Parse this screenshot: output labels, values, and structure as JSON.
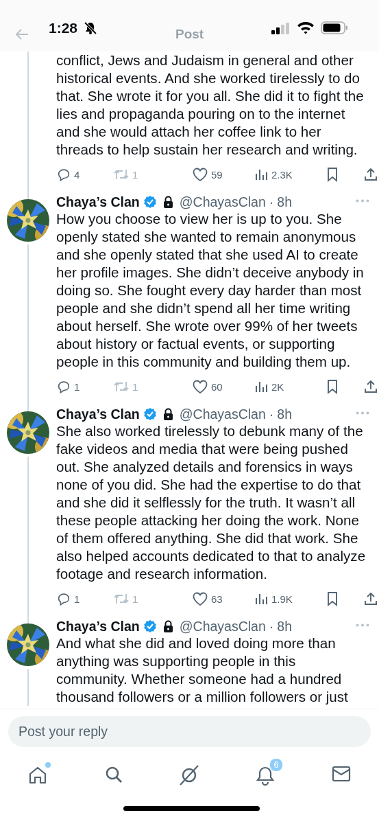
{
  "status_bar": {
    "time": "1:28",
    "silent": true
  },
  "header": {
    "title": "Post"
  },
  "thread": [
    {
      "kind": "continuation",
      "cut_line": "conflict, Jews and Judaism in general and other",
      "text": "historical events. And she worked tirelessly to do that. She wrote it for you all. She did it to fight the lies and propaganda pouring on to the internet and she would attach her coffee link to her threads to help sustain her research and writing.",
      "replies": "4",
      "reposts": "1",
      "reposts_disabled": true,
      "likes": "59",
      "views": "2.3K"
    },
    {
      "kind": "post",
      "name": "Chaya’s Clan",
      "verified": true,
      "protected": true,
      "handle": "@ChayasClan",
      "separator": "·",
      "time": "8h",
      "text": "How you choose to view her is up to you. She openly stated she wanted to remain anonymous and she openly stated that she used AI to create her profile images. She didn’t deceive anybody in doing so. She fought every day harder than most people and she didn’t spend all her time writing about herself. She wrote over 99% of her tweets about history or factual events, or supporting people in this community and building them up.",
      "replies": "1",
      "reposts": "1",
      "reposts_disabled": true,
      "likes": "60",
      "views": "2K"
    },
    {
      "kind": "post",
      "name": "Chaya’s Clan",
      "verified": true,
      "protected": true,
      "handle": "@ChayasClan",
      "separator": "·",
      "time": "8h",
      "text": "She also worked tirelessly to debunk many of the fake videos and media that were being pushed out. She analyzed details and forensics in ways none of you did. She had the expertise to do that and she did it selflessly for the truth. It wasn’t all these people attacking her doing the work. None of them offered anything. She did that work. She also helped accounts dedicated to that to analyze footage and research information.",
      "replies": "1",
      "reposts": "1",
      "reposts_disabled": true,
      "likes": "63",
      "views": "1.9K"
    },
    {
      "kind": "post",
      "name": "Chaya’s Clan",
      "verified": true,
      "protected": true,
      "handle": "@ChayasClan",
      "separator": "·",
      "time": "8h",
      "text": "And what she did and loved doing more than anything was supporting people in this community. Whether someone had a hundred",
      "cut_line": "thousand followers or a million followers or just"
    }
  ],
  "reply": {
    "placeholder": "Post your reply"
  },
  "tab_bar": {
    "items": [
      {
        "kind": "home",
        "dot": true
      },
      {
        "kind": "search"
      },
      {
        "kind": "grok"
      },
      {
        "kind": "notifications",
        "badge": "6"
      },
      {
        "kind": "messages"
      }
    ]
  }
}
